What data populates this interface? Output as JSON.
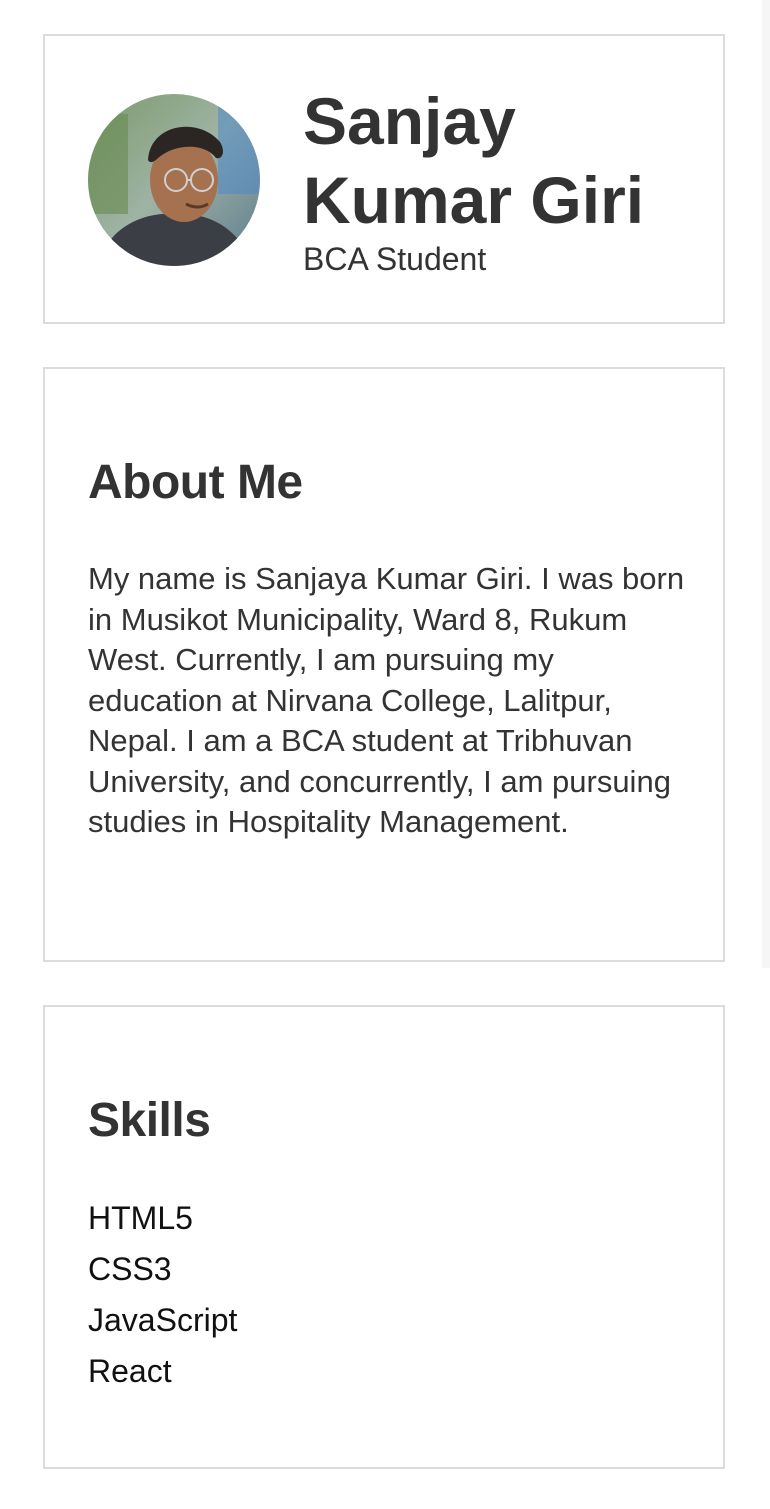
{
  "profile": {
    "name_line1": "Sanjay",
    "name_line2": "Kumar Giri",
    "subtitle": "BCA Student"
  },
  "about": {
    "title": "About Me",
    "text": "My name is Sanjaya Kumar Giri. I was born in Musikot Municipality, Ward 8, Rukum West. Currently, I am pursuing my education at Nirvana College, Lalitpur, Nepal. I am a BCA student at Tribhuvan University, and concurrently, I am pursuing studies in Hospitality Management."
  },
  "skills": {
    "title": "Skills",
    "items": [
      "HTML5",
      "CSS3",
      "JavaScript",
      "React"
    ]
  },
  "colors": {
    "text": "#333333",
    "border": "#dcdcdc",
    "background": "#ffffff"
  }
}
